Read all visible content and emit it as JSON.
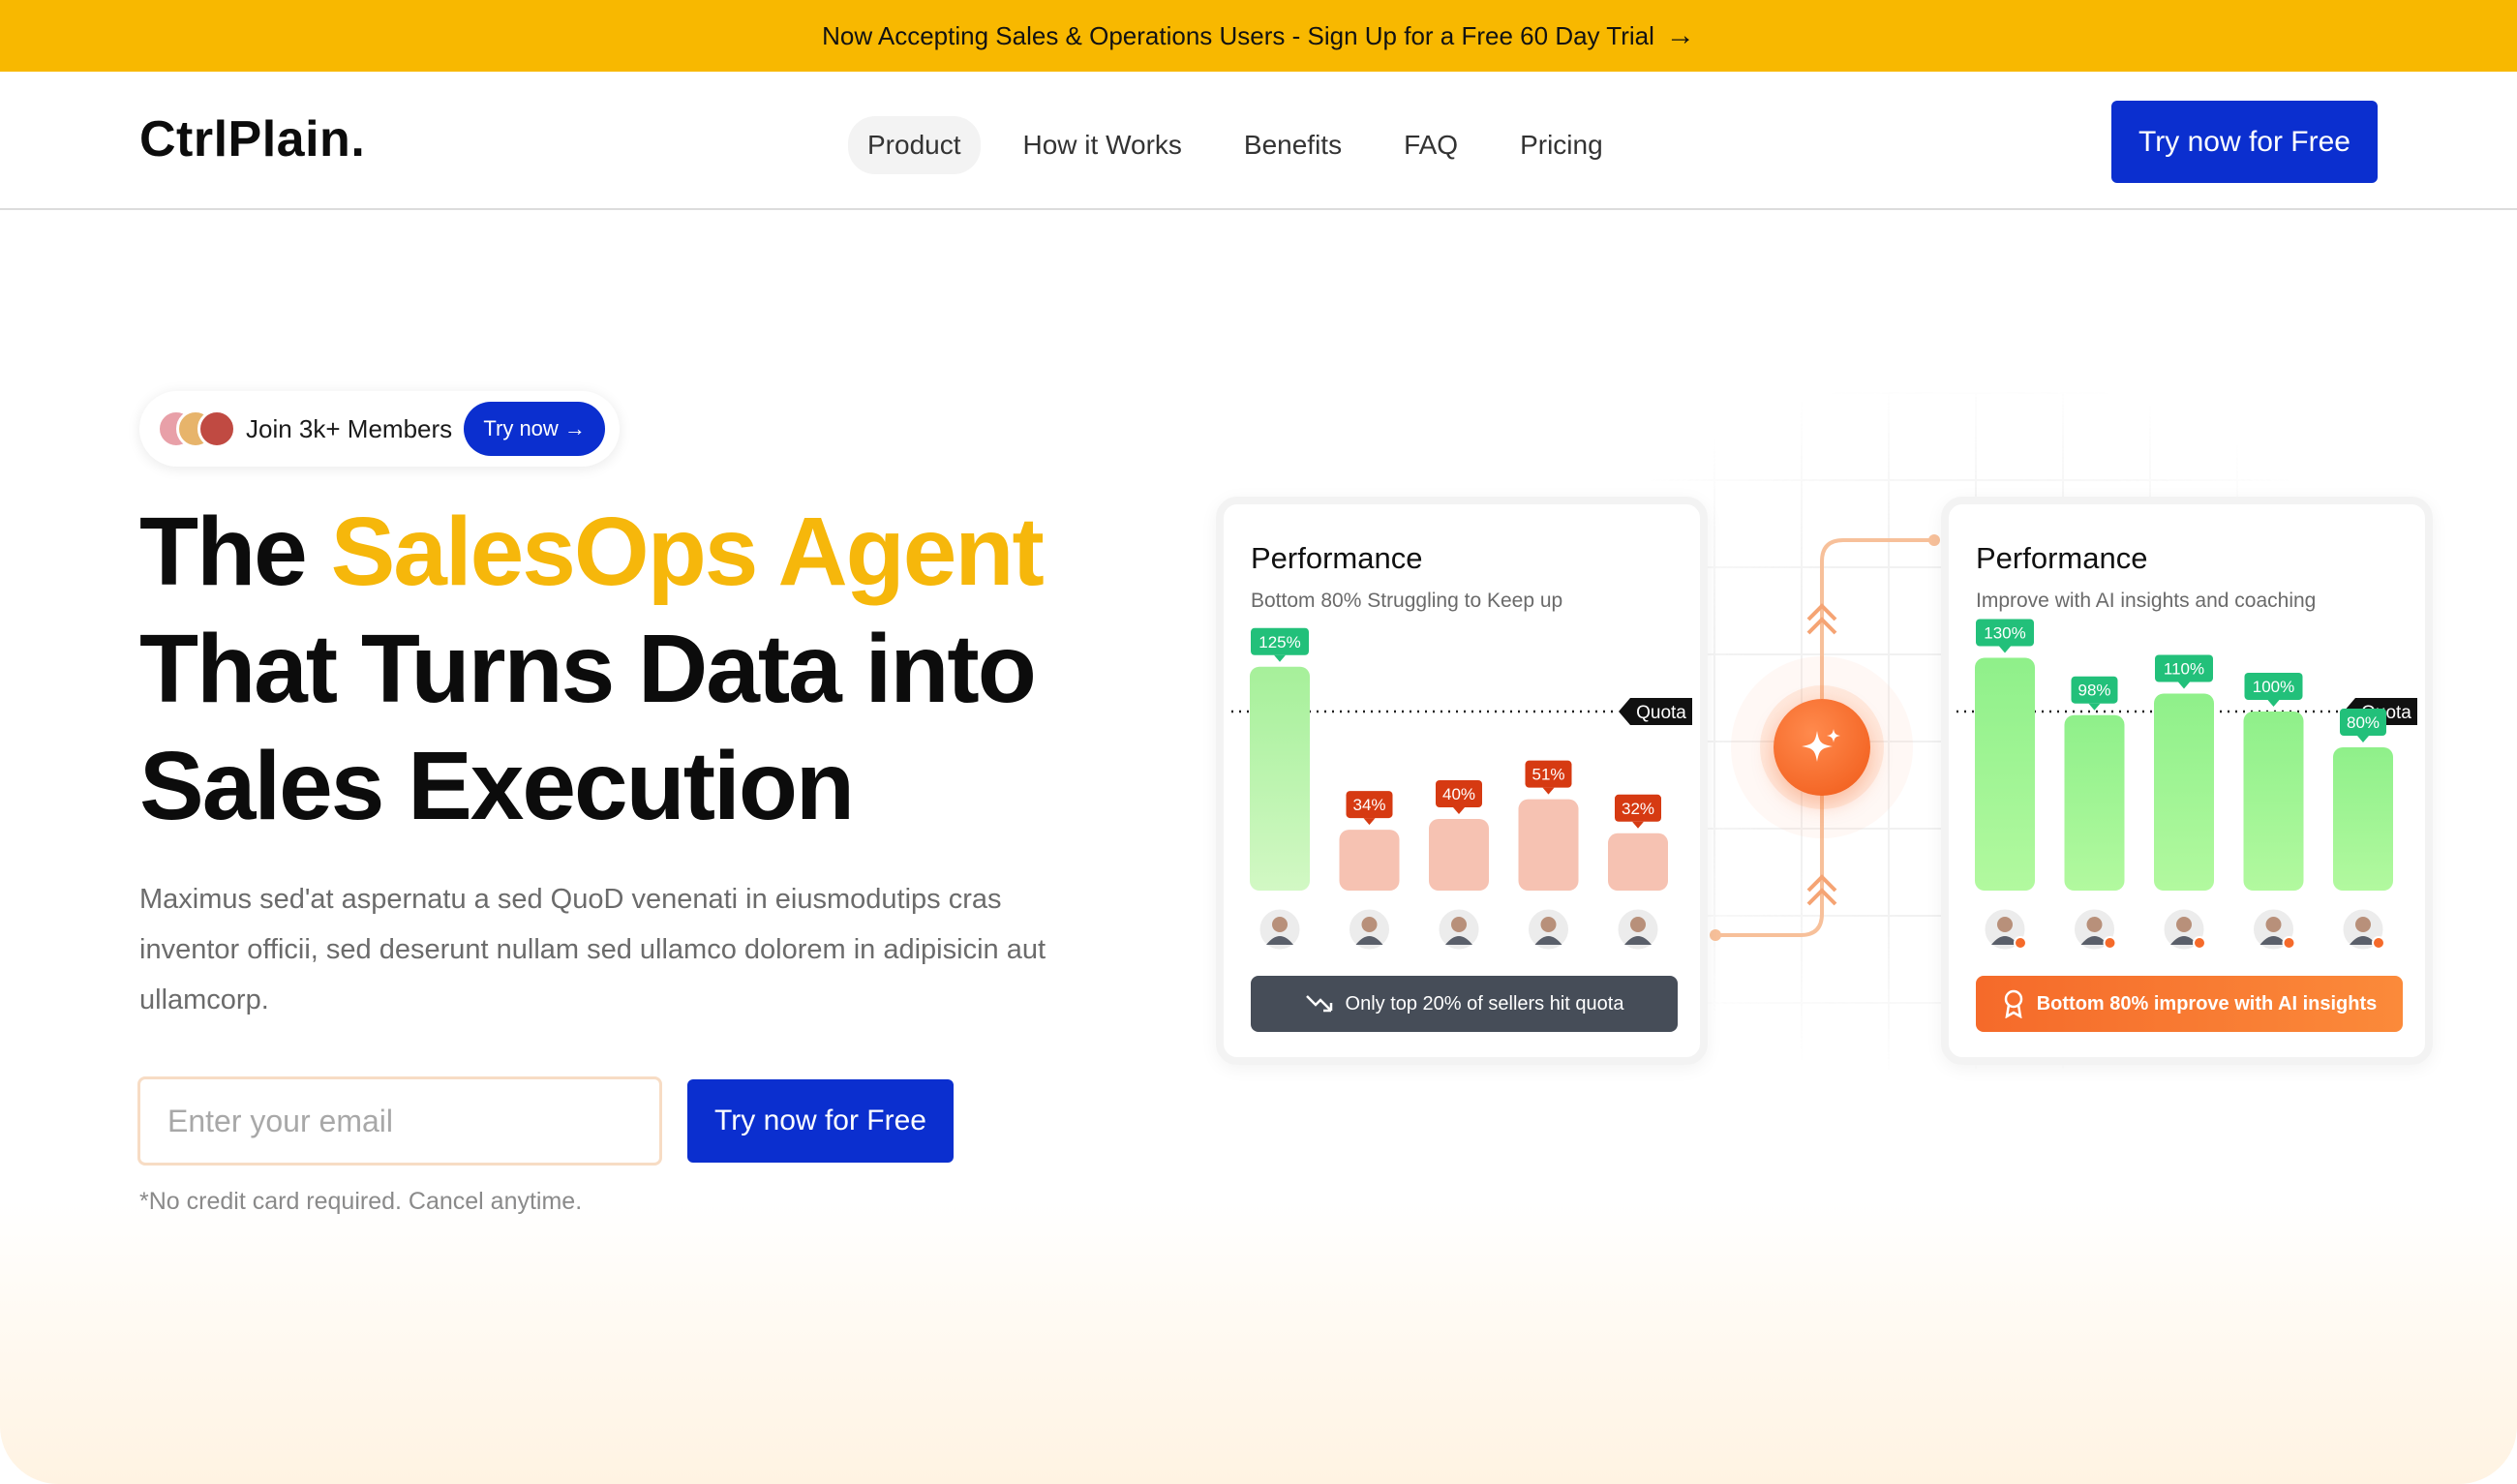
{
  "announcement": {
    "text": "Now Accepting Sales & Operations Users - Sign Up for a Free 60 Day Trial",
    "arrow_icon": "arrow-right-icon"
  },
  "header": {
    "logo": "CtrlPlain.",
    "nav": [
      {
        "label": "Product",
        "active": true
      },
      {
        "label": "How it Works",
        "active": false
      },
      {
        "label": "Benefits",
        "active": false
      },
      {
        "label": "FAQ",
        "active": false
      },
      {
        "label": "Pricing",
        "active": false
      }
    ],
    "cta": "Try now for Free"
  },
  "hero": {
    "members_text": "Join 3k+ Members",
    "members_button": "Try now →",
    "headline_pre": "The ",
    "headline_accent": "SalesOps Agent",
    "headline_line2": "That Turns Data into",
    "headline_line3": "Sales Execution",
    "subtext": "Maximus sed'at aspernatu a sed QuoD venenati in eiusmodutips cras inventor officii, sed deserunt nullam sed ullamco dolorem in adipisicin aut ullamcorp.",
    "email_placeholder": "Enter your email",
    "cta": "Try now for Free",
    "disclaimer": "*No credit card required. Cancel anytime."
  },
  "colors": {
    "brand_blue": "#0b2fcf",
    "accent_yellow": "#f6b70b",
    "banner_yellow": "#f8b800",
    "green": "#22c07a",
    "red": "#d63a12",
    "orange": "#f56a2a"
  },
  "chart_data": [
    {
      "type": "bar",
      "title": "Performance",
      "subtitle": "Bottom 80% Struggling to Keep up",
      "categories": [
        "",
        "",
        "",
        "",
        ""
      ],
      "values": [
        125,
        34,
        40,
        51,
        32
      ],
      "labels": [
        "125%",
        "34%",
        "40%",
        "51%",
        "32%"
      ],
      "quota_label": "Quota",
      "quota": 100,
      "ylim": [
        0,
        140
      ],
      "banner": "Only top 20% of sellers hit quota",
      "banner_icon": "trend-down-icon"
    },
    {
      "type": "bar",
      "title": "Performance",
      "subtitle": "Improve with AI insights and coaching",
      "categories": [
        "",
        "",
        "",
        "",
        ""
      ],
      "values": [
        130,
        98,
        110,
        100,
        80
      ],
      "labels": [
        "130%",
        "98%",
        "110%",
        "100%",
        "80%"
      ],
      "quota_label": "Quota",
      "quota": 100,
      "ylim": [
        0,
        140
      ],
      "banner": "Bottom 80% improve with AI insights",
      "banner_icon": "award-icon"
    }
  ]
}
